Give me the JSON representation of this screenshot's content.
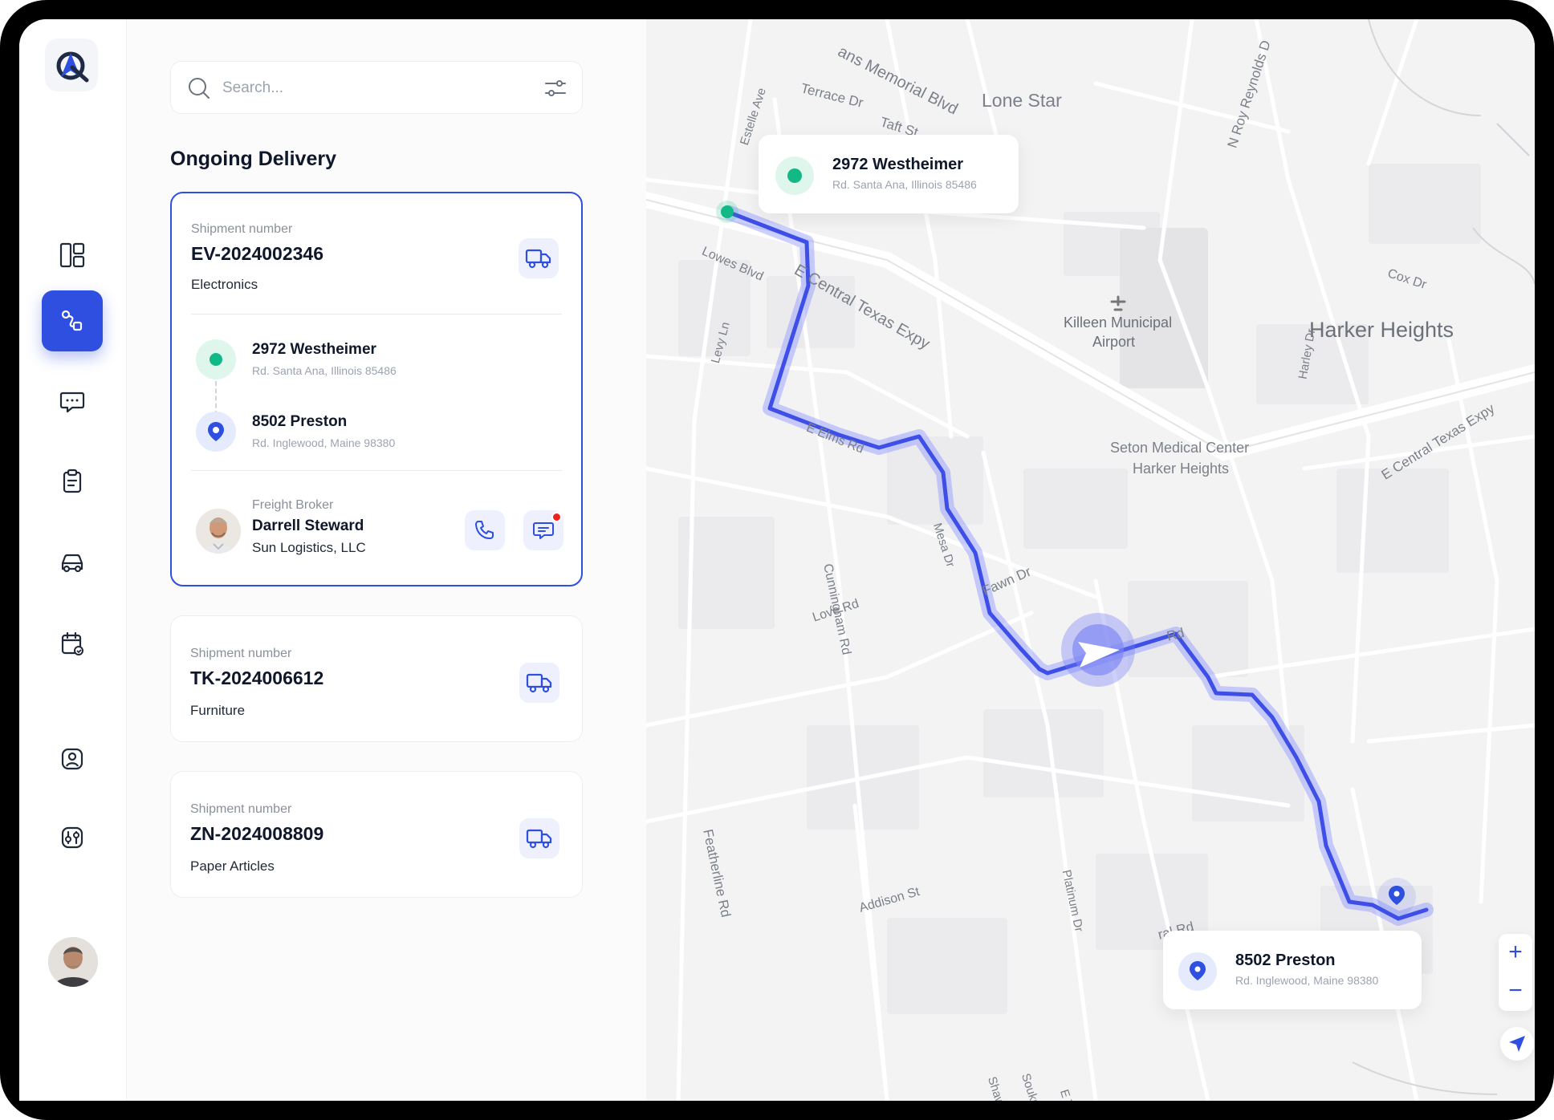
{
  "app": {
    "logo_icon": "logo-mark",
    "accent": "#2e4fe0",
    "pickup_color": "#12b886"
  },
  "sidebar": {
    "items": [
      {
        "name": "dashboard",
        "icon": "layout-grid-icon"
      },
      {
        "name": "routes",
        "icon": "route-icon",
        "active": true
      },
      {
        "name": "messages",
        "icon": "chat-icon"
      },
      {
        "name": "orders",
        "icon": "clipboard-icon"
      },
      {
        "name": "vehicles",
        "icon": "car-icon"
      },
      {
        "name": "calendar",
        "icon": "calendar-icon"
      },
      {
        "name": "profile",
        "icon": "user-icon"
      },
      {
        "name": "settings",
        "icon": "settings-icon"
      }
    ]
  },
  "search": {
    "placeholder": "Search..."
  },
  "section_title": "Ongoing Delivery",
  "shipments": [
    {
      "label": "Shipment number",
      "number": "EV-2024002346",
      "category": "Electronics",
      "from": {
        "name": "2972 Westheimer",
        "address": "Rd. Santa Ana, Illinois 85486"
      },
      "to": {
        "name": "8502 Preston",
        "address": "Rd. Inglewood, Maine 98380"
      },
      "broker": {
        "role": "Freight Broker",
        "name": "Darrell Steward",
        "company": "Sun Logistics, LLC"
      }
    },
    {
      "label": "Shipment number",
      "number": "TK-2024006612",
      "category": "Furniture"
    },
    {
      "label": "Shipment number",
      "number": "ZN-2024008809",
      "category": "Paper Articles"
    }
  ],
  "map": {
    "labels": {
      "memorial": "ans Memorial Blvd",
      "terrace": "Terrace Dr",
      "taft": "Taft St",
      "lone_star": "Lone Star",
      "reynolds": "N Roy Reynolds D",
      "estelle": "Estelle Ave",
      "lowes": "Lowes Blvd",
      "ectx1": "E Central Texas Expy",
      "ectx2": "E Central Texas Expy",
      "cox": "Cox Dr",
      "airport": "Killeen Municipal",
      "airport2": "Airport",
      "harker": "Harker Heights",
      "harley": "Harley Dr",
      "levy": "Levy Ln",
      "elms": "E Elms Rd",
      "seton1": "Seton Medical Center",
      "seton2": "Harker Heights",
      "mesa": "Mesa Dr",
      "cunningham": "Cunningham Rd",
      "fawn": "Fawn Dr",
      "love": "Love Rd",
      "rd": "Rd",
      "featherline": "Featherline Rd",
      "platinum": "Platinum Dr",
      "addison": "Addison St",
      "central_rd": "ral Rd",
      "shaw": "Shaw Ln",
      "soukup": "Soukup Ln",
      "etri": "E Tri"
    },
    "popup_from": {
      "name": "2972 Westheimer",
      "address": "Rd. Santa Ana, Illinois 85486"
    },
    "popup_to": {
      "name": "8502 Preston",
      "address": "Rd. Inglewood, Maine 98380"
    },
    "zoom_in": "+",
    "zoom_out": "−"
  }
}
